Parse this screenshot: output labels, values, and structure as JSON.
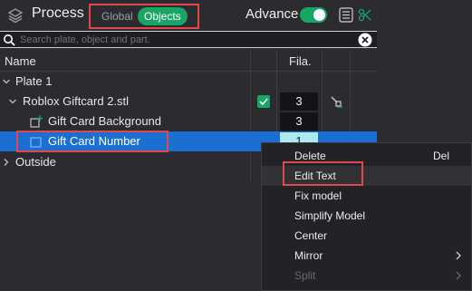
{
  "header": {
    "title": "Process",
    "mode_global": "Global",
    "mode_objects": "Objects",
    "advance_label": "Advance",
    "advance_on": true
  },
  "search": {
    "placeholder": "Search plate, object and part."
  },
  "table": {
    "col_name": "Name",
    "col_fila": "Fila."
  },
  "tree": {
    "plate": "Plate 1",
    "object": "Roblox Giftcard 2.stl",
    "object_fila": "3",
    "part1": "Gift Card Background",
    "part1_fila": "3",
    "part2": "Gift Card Number",
    "part2_fila": "1",
    "outside": "Outside"
  },
  "menu": {
    "items": [
      {
        "label": "Delete",
        "shortcut": "Del"
      },
      {
        "label": "Edit Text"
      },
      {
        "label": "Fix model"
      },
      {
        "label": "Simplify Model"
      },
      {
        "label": "Center"
      },
      {
        "label": "Mirror"
      },
      {
        "label": "Split"
      }
    ]
  },
  "colors": {
    "accent": "#18a566",
    "selection": "#1a6fd0",
    "highlight_box": "#e0484b",
    "background": "#2b2b30"
  }
}
